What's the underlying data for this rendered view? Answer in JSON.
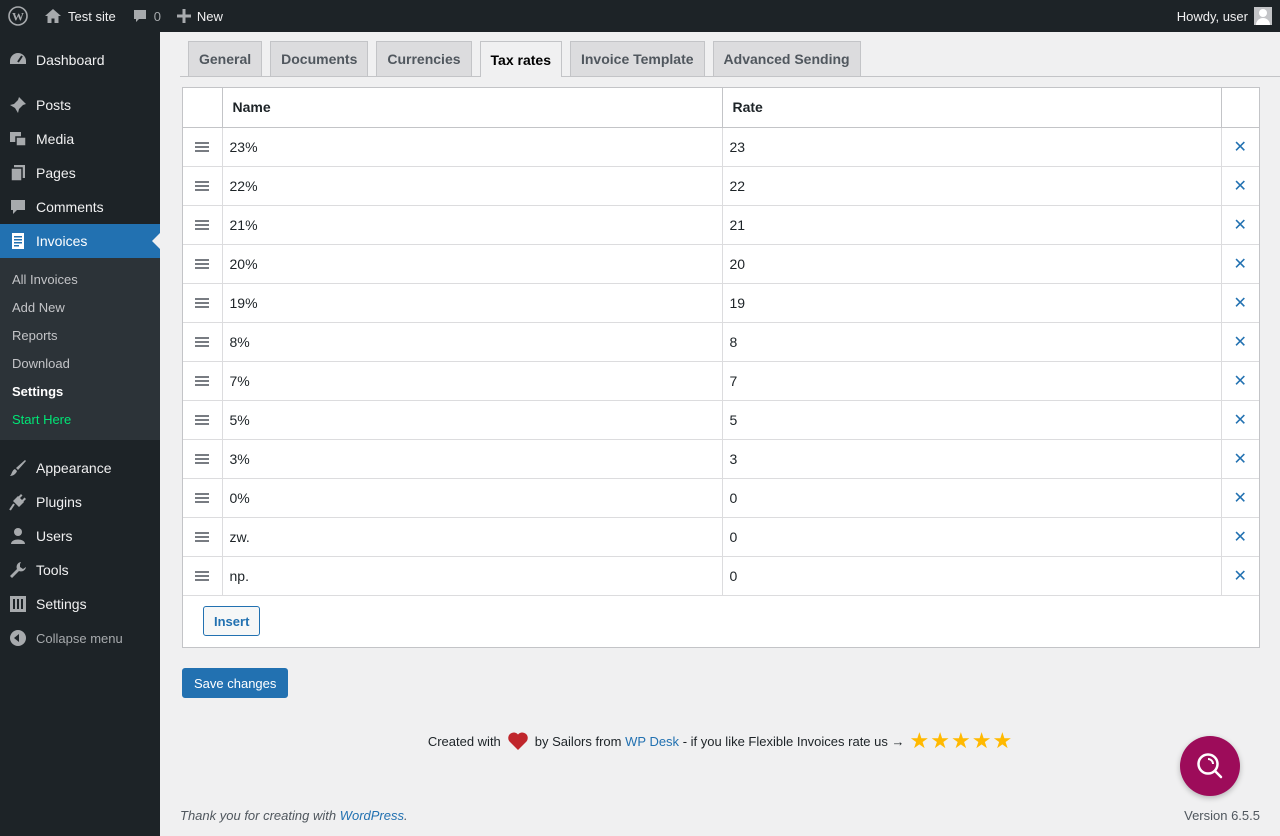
{
  "adminbar": {
    "site_name": "Test site",
    "comments_count": "0",
    "new_label": "New",
    "greeting": "Howdy, user"
  },
  "sidebar": {
    "items": [
      {
        "label": "Dashboard",
        "icon": "dashboard-icon"
      },
      {
        "label": "Posts",
        "icon": "pin-icon"
      },
      {
        "label": "Media",
        "icon": "media-icon"
      },
      {
        "label": "Pages",
        "icon": "pages-icon"
      },
      {
        "label": "Comments",
        "icon": "comment-icon"
      },
      {
        "label": "Invoices",
        "icon": "invoice-icon"
      },
      {
        "label": "Appearance",
        "icon": "brush-icon"
      },
      {
        "label": "Plugins",
        "icon": "plug-icon"
      },
      {
        "label": "Users",
        "icon": "user-icon"
      },
      {
        "label": "Tools",
        "icon": "wrench-icon"
      },
      {
        "label": "Settings",
        "icon": "settings-icon"
      }
    ],
    "submenu": [
      "All Invoices",
      "Add New",
      "Reports",
      "Download",
      "Settings",
      "Start Here"
    ],
    "collapse_label": "Collapse menu"
  },
  "tabs": [
    "General",
    "Documents",
    "Currencies",
    "Tax rates",
    "Invoice Template",
    "Advanced Sending"
  ],
  "active_tab": "Tax rates",
  "table": {
    "headers": {
      "name": "Name",
      "rate": "Rate"
    },
    "rows": [
      {
        "name": "23%",
        "rate": "23"
      },
      {
        "name": "22%",
        "rate": "22"
      },
      {
        "name": "21%",
        "rate": "21"
      },
      {
        "name": "20%",
        "rate": "20"
      },
      {
        "name": "19%",
        "rate": "19"
      },
      {
        "name": "8%",
        "rate": "8"
      },
      {
        "name": "7%",
        "rate": "7"
      },
      {
        "name": "5%",
        "rate": "5"
      },
      {
        "name": "3%",
        "rate": "3"
      },
      {
        "name": "0%",
        "rate": "0"
      },
      {
        "name": "zw.",
        "rate": "0"
      },
      {
        "name": "np.",
        "rate": "0"
      }
    ],
    "delete_glyph": "✕"
  },
  "buttons": {
    "insert": "Insert",
    "save": "Save changes"
  },
  "rating": {
    "created_with": "Created with",
    "by_sailors": "by Sailors from",
    "wpdesk_link": "WP Desk",
    "rate_us": "- if you like Flexible Invoices rate us →",
    "stars": 5
  },
  "footer": {
    "thanks": "Thank you for creating with",
    "wordpress_link": "WordPress",
    "thanks_end": ".",
    "version": "Version 6.5.5"
  },
  "colors": {
    "accent": "#2271b1",
    "admin_dark": "#1d2327",
    "star": "#ffb900",
    "fab": "#9d0c5a",
    "heart": "#c0262c"
  }
}
